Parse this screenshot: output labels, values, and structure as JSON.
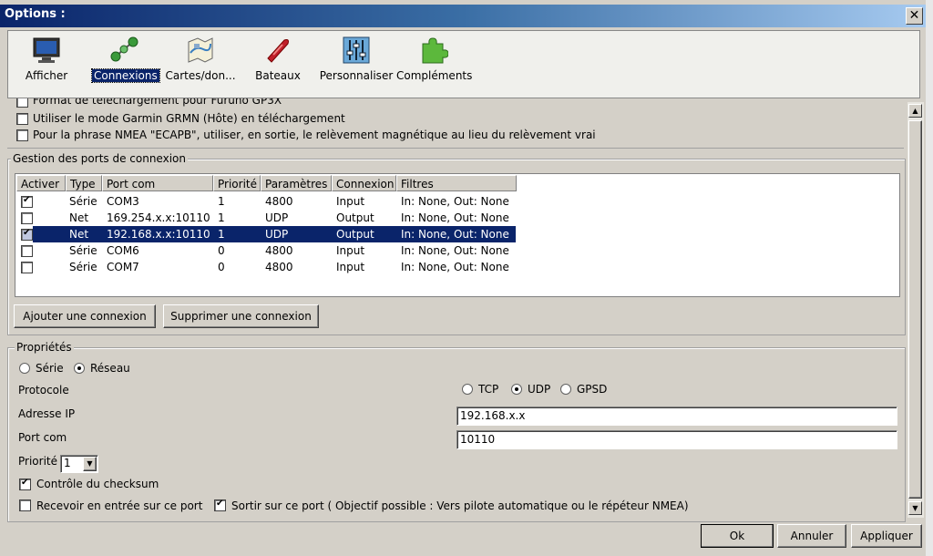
{
  "window": {
    "title": "Options :",
    "close_glyph": "✕"
  },
  "toolbar": {
    "items": [
      {
        "label": "Afficher",
        "icon": "monitor-icon"
      },
      {
        "label": "Connexions",
        "icon": "connections-icon",
        "selected": true
      },
      {
        "label": "Cartes/don...",
        "icon": "charts-icon"
      },
      {
        "label": "Bateaux",
        "icon": "boat-icon"
      },
      {
        "label": "Personnaliser",
        "icon": "sliders-icon"
      },
      {
        "label": "Compléments",
        "icon": "puzzle-icon"
      }
    ]
  },
  "top_options": {
    "partial": "Format de téléchargement pour Furuno GP3X",
    "garmin": "Utiliser le mode Garmin GRMN (Hôte) en téléchargement",
    "nmea": "Pour la phrase NMEA \"ECAPB\", utiliser, en sortie, le relèvement magnétique  au lieu du relèvement vrai"
  },
  "ports": {
    "legend": "Gestion des ports de connexion",
    "columns": [
      "Activer",
      "Type",
      "Port com",
      "Priorité",
      "Paramètres",
      "Connexion",
      "Filtres"
    ],
    "rows": [
      {
        "active": true,
        "type": "Série",
        "port": "COM3",
        "priority": "1",
        "params": "4800",
        "conn": "Input",
        "filters": "In: None, Out: None"
      },
      {
        "active": false,
        "type": "Net",
        "port": "169.254.x.x:10110",
        "priority": "1",
        "params": "UDP",
        "conn": "Output",
        "filters": "In: None, Out: None"
      },
      {
        "active": true,
        "type": "Net",
        "port": "192.168.x.x:10110",
        "priority": "1",
        "params": "UDP",
        "conn": "Output",
        "filters": "In: None, Out: None",
        "selected": true
      },
      {
        "active": false,
        "type": "Série",
        "port": "COM6",
        "priority": "0",
        "params": "4800",
        "conn": "Input",
        "filters": "In: None, Out: None"
      },
      {
        "active": false,
        "type": "Série",
        "port": "COM7",
        "priority": "0",
        "params": "4800",
        "conn": "Input",
        "filters": "In: None, Out: None"
      }
    ],
    "add_button": "Ajouter une connexion",
    "remove_button": "Supprimer une connexion"
  },
  "properties": {
    "legend": "Propriétés",
    "serie": "Série",
    "reseau": "Réseau",
    "protocole_label": "Protocole",
    "tcp": "TCP",
    "udp": "UDP",
    "gpsd": "GPSD",
    "ip_label": "Adresse IP",
    "ip_value": "192.168.x.x",
    "port_label": "Port com",
    "port_value": "10110",
    "priority_label": "Priorité",
    "priority_value": "1",
    "checksum": "Contrôle du checksum",
    "receive": "Recevoir en entrée sur ce port",
    "send": "Sortir sur ce port ( Objectif possible   :   Vers pilote automatique ou le répéteur NMEA)"
  },
  "buttons": {
    "ok": "Ok",
    "cancel": "Annuler",
    "apply": "Appliquer"
  }
}
